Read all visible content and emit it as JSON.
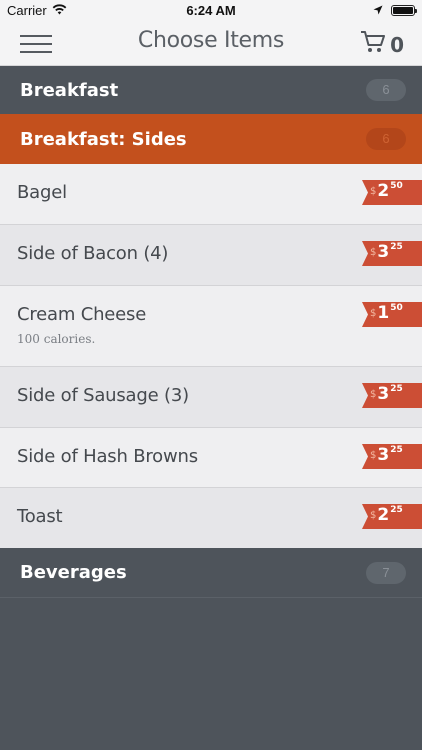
{
  "status_bar": {
    "carrier": "Carrier",
    "time": "6:24 AM"
  },
  "header": {
    "title": "Choose Items",
    "cart_count": "0"
  },
  "sections": {
    "breakfast": {
      "label": "Breakfast",
      "count": "6"
    },
    "breakfast_sides": {
      "label": "Breakfast: Sides",
      "count": "6"
    },
    "beverages": {
      "label": "Beverages",
      "count": "7"
    }
  },
  "items": [
    {
      "name": "Bagel",
      "currency": "$",
      "dollars": "2",
      "cents": "50"
    },
    {
      "name": "Side of Bacon (4)",
      "currency": "$",
      "dollars": "3",
      "cents": "25"
    },
    {
      "name": "Cream Cheese",
      "subtitle": "100 calories.",
      "currency": "$",
      "dollars": "1",
      "cents": "50"
    },
    {
      "name": "Side of Sausage (3)",
      "currency": "$",
      "dollars": "3",
      "cents": "25"
    },
    {
      "name": "Side of Hash Browns",
      "currency": "$",
      "dollars": "3",
      "cents": "25"
    },
    {
      "name": "Toast",
      "currency": "$",
      "dollars": "2",
      "cents": "25"
    }
  ],
  "colors": {
    "accent": "#c3501d",
    "price_tag": "#cc4e35",
    "dark_background": "#4e545b",
    "row_light": "#efeff1",
    "row_dark": "#e6e6e9"
  },
  "icons": [
    "wifi-icon",
    "location-arrow-icon",
    "battery-icon",
    "hamburger-menu-icon",
    "cart-icon"
  ]
}
